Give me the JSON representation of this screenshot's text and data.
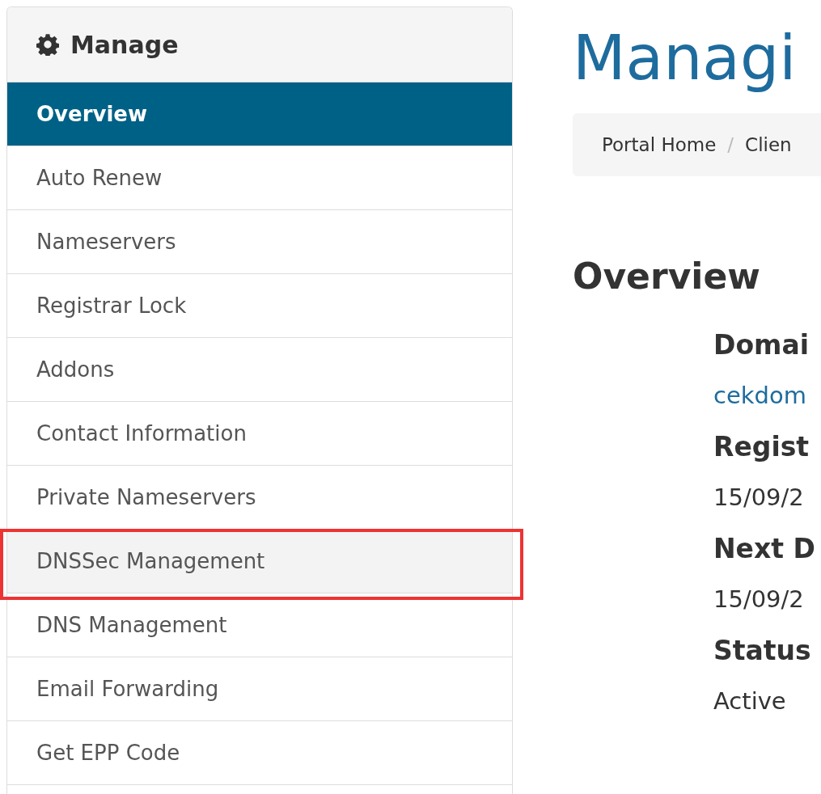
{
  "sidebar": {
    "title": "Manage",
    "items": [
      {
        "label": "Overview",
        "selected": true,
        "highlighted": false
      },
      {
        "label": "Auto Renew",
        "selected": false,
        "highlighted": false
      },
      {
        "label": "Nameservers",
        "selected": false,
        "highlighted": false
      },
      {
        "label": "Registrar Lock",
        "selected": false,
        "highlighted": false
      },
      {
        "label": "Addons",
        "selected": false,
        "highlighted": false
      },
      {
        "label": "Contact Information",
        "selected": false,
        "highlighted": false
      },
      {
        "label": "Private Nameservers",
        "selected": false,
        "highlighted": false
      },
      {
        "label": "DNSSec Management",
        "selected": false,
        "highlighted": true
      },
      {
        "label": "DNS Management",
        "selected": false,
        "highlighted": false
      },
      {
        "label": "Email Forwarding",
        "selected": false,
        "highlighted": false
      },
      {
        "label": "Get EPP Code",
        "selected": false,
        "highlighted": false
      }
    ]
  },
  "page": {
    "title": "Managi",
    "breadcrumb": [
      "Portal Home",
      "Clien"
    ],
    "breadcrumb_separator": "/",
    "section": "Overview",
    "fields": [
      {
        "label": "Domai",
        "value": "cekdom",
        "kind": "link"
      },
      {
        "label": "Regist",
        "value": "15/09/2",
        "kind": "text"
      },
      {
        "label": "Next D",
        "value": "15/09/2",
        "kind": "text"
      },
      {
        "label": "Status",
        "value": "Active",
        "kind": "text"
      }
    ]
  }
}
